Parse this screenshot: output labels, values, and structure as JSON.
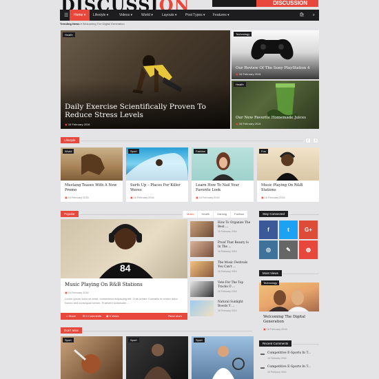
{
  "site": {
    "logo_main": "DISCUSSI",
    "logo_accent": "ON",
    "ad_text": "DISCUSSION"
  },
  "nav": {
    "menu_icon": "menu-icon",
    "items": [
      {
        "label": "Home ▾"
      },
      {
        "label": "Lifestyle ▾"
      },
      {
        "label": "Videos ▾"
      },
      {
        "label": "World ▾"
      },
      {
        "label": "Layouts ▾"
      },
      {
        "label": "Post Types ▾"
      },
      {
        "label": "Features ▾"
      }
    ],
    "cart_icon": "cart-icon",
    "search_icon": "search-icon"
  },
  "trending": {
    "label": "Trending News »",
    "text": "Welcoming The Digital Generation"
  },
  "hero": {
    "main": {
      "tag": "Health",
      "title": "Daily Exercise Scientifically Proven To Reduce Stress Levels",
      "date": "16 February 2016"
    },
    "side": [
      {
        "tag": "Technology",
        "title": "Our Review Of The Sony PlayStation 4",
        "date": "16 February 2016"
      },
      {
        "tag": "Health",
        "title": "Our New Favorite Homemade Juices",
        "date": "16 February 2016"
      }
    ]
  },
  "lifestyle": {
    "label": "Lifestyle",
    "prev": "‹",
    "next": "›",
    "cards": [
      {
        "tag": "World",
        "title": "Mustang Teases With A New Promo",
        "date": "16 February 2016"
      },
      {
        "tag": "Sport",
        "title": "Surfs Up – Places For Killer Waves",
        "date": "16 February 2016"
      },
      {
        "tag": "Fashion",
        "title": "Learn How To Nail Your Favorite Look",
        "date": "16 February 2016"
      },
      {
        "tag": "Fun",
        "title": "Music Playing On R&B Stations",
        "date": "16 February 2016"
      }
    ]
  },
  "popular": {
    "label": "Popular",
    "tabs": [
      "Music",
      "Health",
      "Gaming",
      "Fashion"
    ],
    "main": {
      "title": "Music Playing On R&B Stations",
      "date": "16 February 2016",
      "excerpt": "Lorem ipsum dolor sit amet, consectetur adipiscing elit. Cras ornare Convallis in ornare dolor. Donec sed consequat rutrum. Praesent sollicitudin ...",
      "share": "Share",
      "comments": "0 Comments",
      "views": "6 Views",
      "read_more": "Read More"
    },
    "side": [
      {
        "title": "How To Organize The Best ...",
        "date": "16 February 2016"
      },
      {
        "title": "Proof That Beauty Is In The ...",
        "date": "16 February 2016"
      },
      {
        "title": "The Music Festivals You Can't ...",
        "date": "16 February 2016"
      },
      {
        "title": "Vote For The Top Tracks O ...",
        "date": "16 February 2016"
      },
      {
        "title": "Natural Sunlight Boosts Y ...",
        "date": "16 February 2016"
      }
    ]
  },
  "stay_connected": {
    "label": "Stay Connected",
    "social": [
      {
        "name": "facebook-icon",
        "glyph": "f",
        "color": "#3b5998"
      },
      {
        "name": "twitter-icon",
        "glyph": "t",
        "color": "#1da1f2"
      },
      {
        "name": "google-plus-icon",
        "glyph": "G+",
        "color": "#dd4b39"
      },
      {
        "name": "instagram-icon",
        "glyph": "◎",
        "color": "#3f729b"
      },
      {
        "name": "edit-icon",
        "glyph": "✎",
        "color": "#666666"
      },
      {
        "name": "dribbble-icon",
        "glyph": "◍",
        "color": "#e8483b"
      }
    ]
  },
  "most_views": {
    "label": "Most Views",
    "tag": "Technology",
    "title": "Welcoming The Digital Generation",
    "date": "16 February 2016"
  },
  "recent_comments": {
    "label": "Recent Comments",
    "items": [
      {
        "title": "Competitive E-Sports In T...",
        "date": "16 February 2016"
      },
      {
        "title": "Competitive E-Sports In T...",
        "date": "16 February 2016"
      }
    ]
  },
  "dont_miss": {
    "label": "Don't Miss",
    "cards": [
      {
        "tag": "Sport"
      },
      {
        "tag": "Sport"
      },
      {
        "tag": "Sport"
      }
    ]
  },
  "colors": {
    "accent": "#e8483b",
    "dark": "#1d1d1f",
    "page_bg": "#e4e4e7"
  }
}
